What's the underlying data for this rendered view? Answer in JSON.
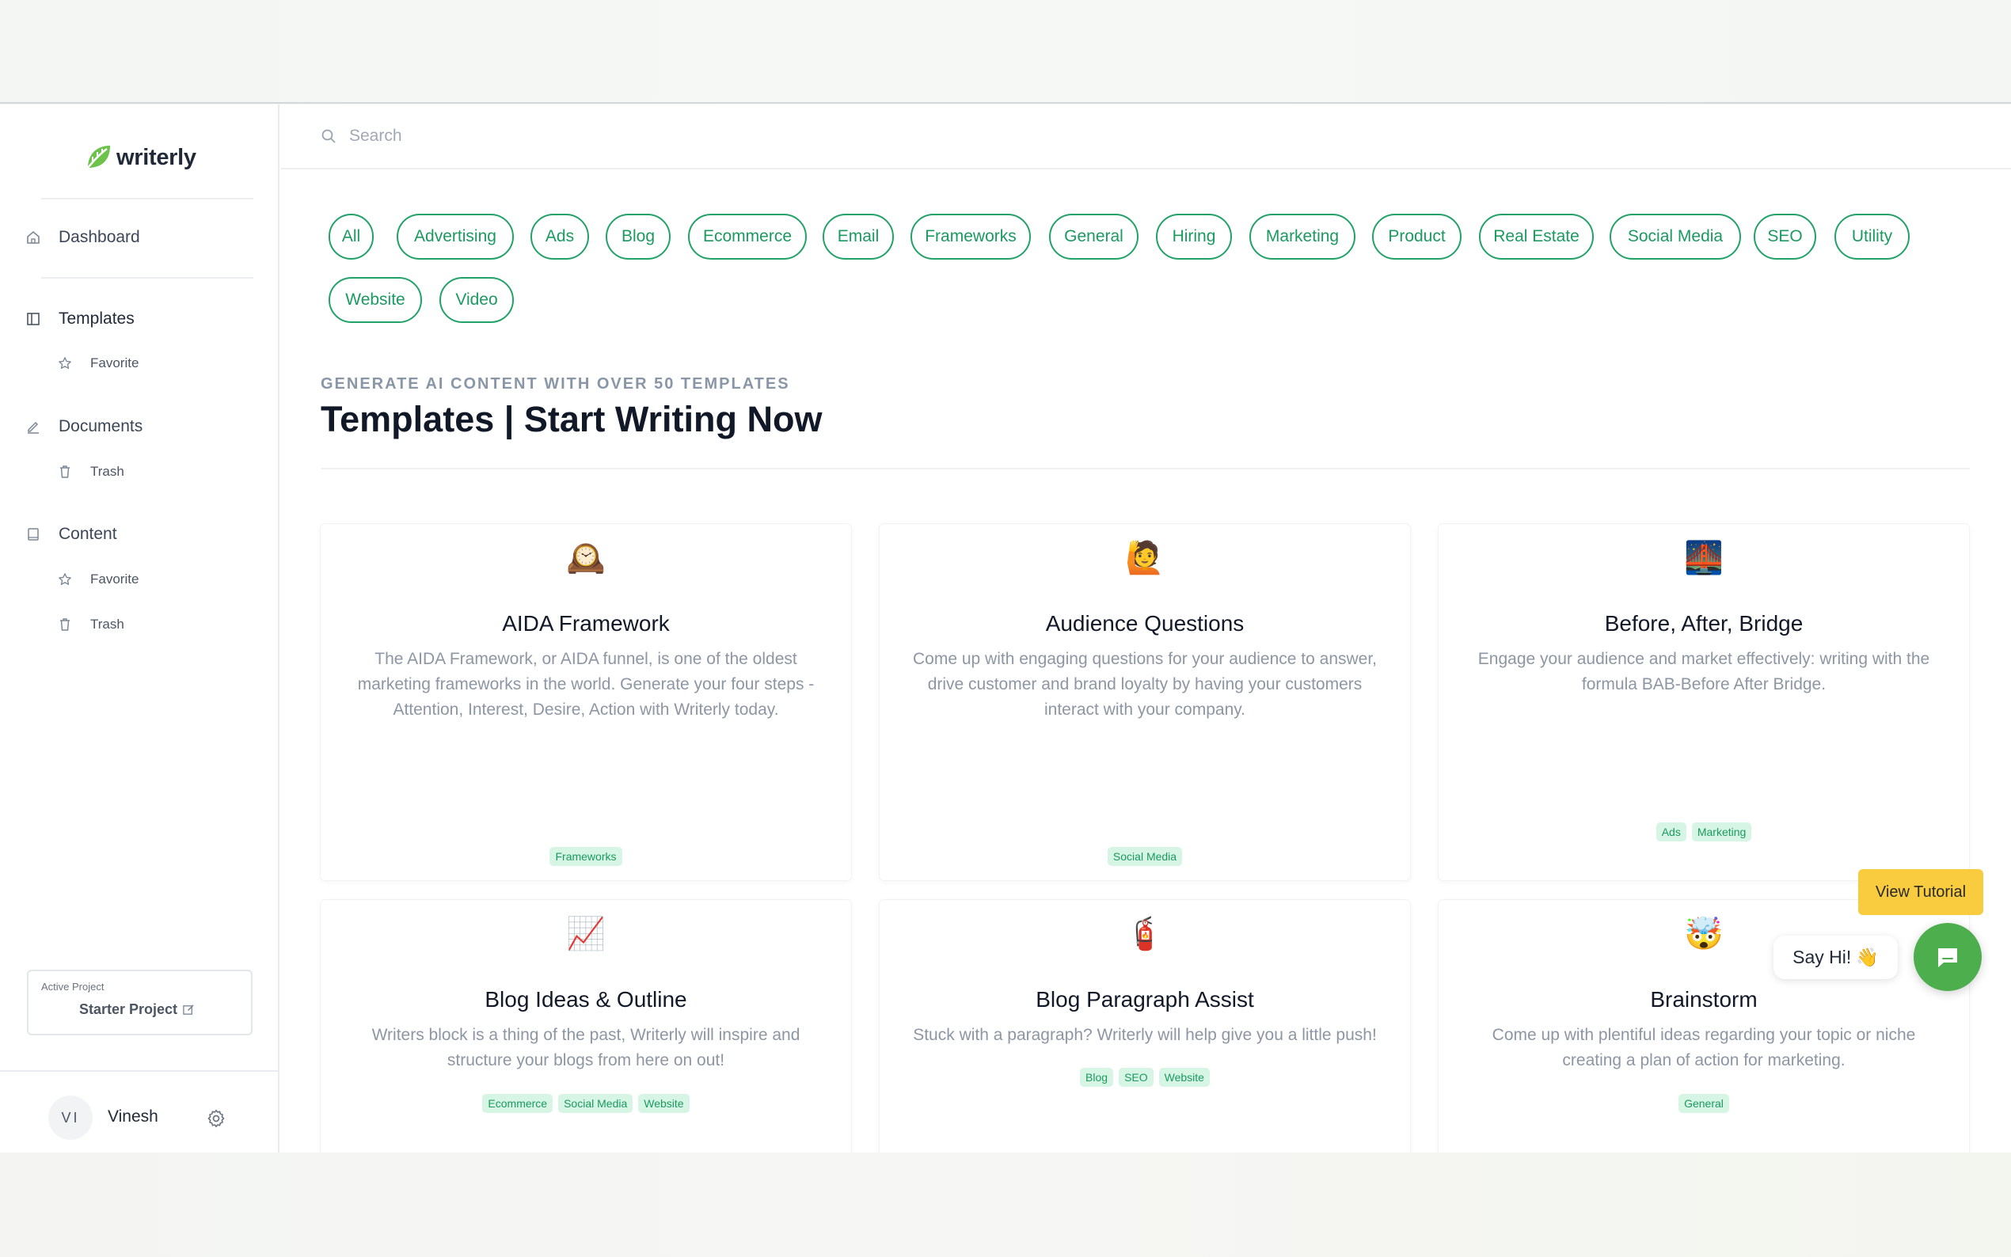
{
  "brand": {
    "name": "writerly",
    "accent": "#22a268"
  },
  "sidebar": {
    "dashboard": "Dashboard",
    "templates": "Templates",
    "templates_favorite": "Favorite",
    "documents": "Documents",
    "documents_trash": "Trash",
    "content": "Content",
    "content_favorite": "Favorite",
    "content_trash": "Trash",
    "project_label": "Active Project",
    "project_name": "Starter Project",
    "user_initials": "VI",
    "user_name": "Vinesh"
  },
  "search": {
    "placeholder": "Search"
  },
  "filters": [
    "All",
    "Advertising",
    "Ads",
    "Blog",
    "Ecommerce",
    "Email",
    "Frameworks",
    "General",
    "Hiring",
    "Marketing",
    "Product",
    "Real Estate",
    "Social Media",
    "SEO",
    "Utility",
    "Website",
    "Video"
  ],
  "header": {
    "eyebrow": "GENERATE AI CONTENT WITH OVER 50 TEMPLATES",
    "title": "Templates | Start Writing Now"
  },
  "cards": [
    {
      "emoji": "🕰️",
      "title": "AIDA Framework",
      "desc": "The AIDA Framework, or AIDA funnel, is one of the oldest marketing frameworks in the world. Generate your four steps - Attention, Interest, Desire, Action with Writerly today.",
      "tags": [
        "Frameworks"
      ]
    },
    {
      "emoji": "🙋",
      "title": "Audience Questions",
      "desc": "Come up with engaging questions for your audience to answer, drive customer and brand loyalty by having your customers interact with your company.",
      "tags": [
        "Social Media"
      ]
    },
    {
      "emoji": "🌉",
      "title": "Before, After, Bridge",
      "desc": "Engage your audience and market effectively: writing with the formula BAB-Before After Bridge.",
      "tags": [
        "Ads",
        "Marketing"
      ]
    },
    {
      "emoji": "📈",
      "title": "Blog Ideas & Outline",
      "desc": "Writers block is a thing of the past, Writerly will inspire and structure your blogs from here on out!",
      "tags": [
        "Ecommerce",
        "Social Media",
        "Website"
      ]
    },
    {
      "emoji": "🧯",
      "title": "Blog Paragraph Assist",
      "desc": "Stuck with a paragraph? Writerly will help give you a little push!",
      "tags": [
        "Blog",
        "SEO",
        "Website"
      ]
    },
    {
      "emoji": "🤯",
      "title": "Brainstorm",
      "desc": "Come up with plentiful ideas regarding your topic or niche creating a plan of action for marketing.",
      "tags": [
        "General"
      ]
    }
  ],
  "widgets": {
    "view_tutorial": "View Tutorial",
    "say_hi": "Say Hi!",
    "say_hi_emoji": "👋"
  }
}
